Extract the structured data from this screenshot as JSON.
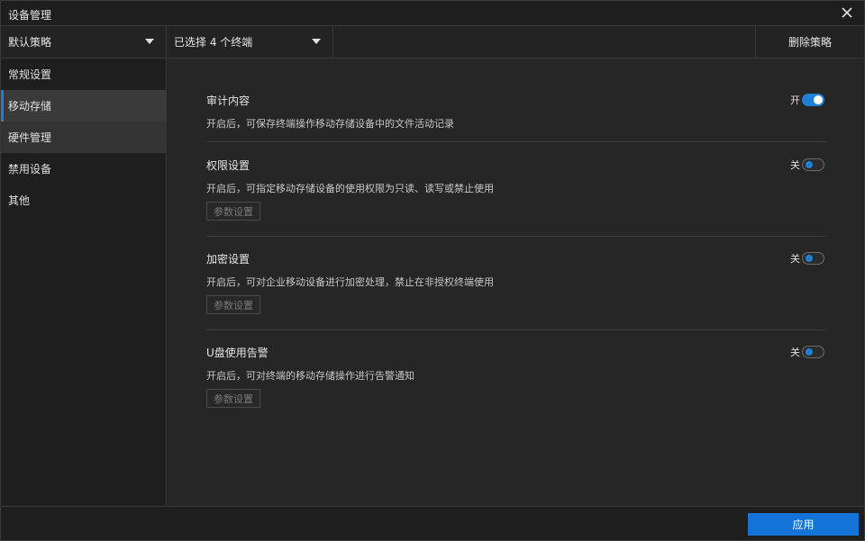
{
  "window": {
    "title": "设备管理",
    "close_icon": "close-icon"
  },
  "toolbar": {
    "policy_select": "默认策略",
    "terminal_select": "已选择 4 个终端",
    "delete_label": "删除策略"
  },
  "sidebar": {
    "items": [
      {
        "label": "常规设置"
      },
      {
        "label": "移动存储"
      },
      {
        "label": "硬件管理"
      },
      {
        "label": "禁用设备"
      },
      {
        "label": "其他"
      }
    ],
    "active_index": 1
  },
  "sections": [
    {
      "title": "审计内容",
      "desc": "开启后，可保存终端操作移动存储设备中的文件活动记录",
      "toggle_label": "开",
      "enabled": true
    },
    {
      "title": "权限设置",
      "desc": "开启后，可指定移动存储设备的使用权限为只读、读写或禁止使用",
      "toggle_label": "关",
      "enabled": false,
      "param_label": "参数设置"
    },
    {
      "title": "加密设置",
      "desc": "开启后，可对企业移动设备进行加密处理，禁止在非授权终端使用",
      "toggle_label": "关",
      "enabled": false,
      "param_label": "参数设置"
    },
    {
      "title": "U盘使用告警",
      "desc": "开启后，可对终端的移动存储操作进行告警通知",
      "toggle_label": "关",
      "enabled": false,
      "param_label": "参数设置"
    }
  ],
  "footer": {
    "apply_label": "应用"
  },
  "colors": {
    "accent": "#1f7fd4",
    "apply_bg": "#1473d6",
    "background": "#262626"
  }
}
